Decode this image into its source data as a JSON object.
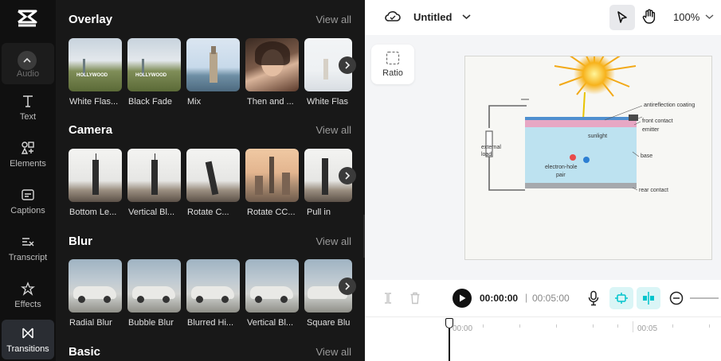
{
  "rail": {
    "items": [
      {
        "label": "Audio"
      },
      {
        "label": "Text"
      },
      {
        "label": "Elements"
      },
      {
        "label": "Captions"
      },
      {
        "label": "Transcript"
      },
      {
        "label": "Effects"
      },
      {
        "label": "Transitions"
      }
    ]
  },
  "panel": {
    "view_all": "View all",
    "sections": [
      {
        "title": "Overlay",
        "items": [
          "White Flas...",
          "Black Fade",
          "Mix",
          "Then and ...",
          "White Flas"
        ]
      },
      {
        "title": "Camera",
        "items": [
          "Bottom Le...",
          "Vertical Bl...",
          "Rotate C...",
          "Rotate CC...",
          "Pull in"
        ]
      },
      {
        "title": "Blur",
        "items": [
          "Radial Blur",
          "Bubble Blur",
          "Blurred Hi...",
          "Vertical Bl...",
          "Square Blu"
        ]
      },
      {
        "title": "Basic"
      }
    ]
  },
  "topbar": {
    "project_title": "Untitled",
    "zoom": "100%"
  },
  "ratio_label": "Ratio",
  "canvas_diagram": {
    "labels": [
      "antireflection coating",
      "front contact",
      "emitter",
      "sunlight",
      "external load",
      "base",
      "electron-hole",
      "pair",
      "rear contact"
    ]
  },
  "player": {
    "current_time": "00:00:00",
    "separator": "|",
    "duration": "00:05:00"
  },
  "timeline": {
    "ticks": [
      "00:00",
      "00:05"
    ]
  },
  "colors": {
    "accent": "#00c4cc",
    "rail_bg": "#101010",
    "panel_bg": "#181818"
  }
}
